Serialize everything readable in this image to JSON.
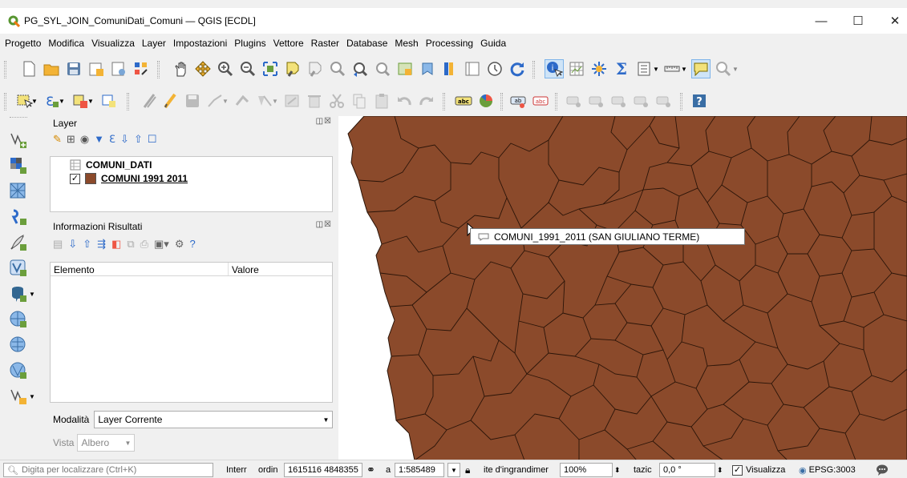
{
  "window": {
    "title": "PG_SYL_JOIN_ComuniDati_Comuni — QGIS [ECDL]",
    "minimize": "—",
    "maximize": "☐",
    "close": "✕"
  },
  "menu": [
    "Progetto",
    "Modifica",
    "Visualizza",
    "Layer",
    "Impostazioni",
    "Plugins",
    "Vettore",
    "Raster",
    "Database",
    "Mesh",
    "Processing",
    "Guida"
  ],
  "layer_panel": {
    "title": "Layer",
    "layers": [
      {
        "name": "COMUNI_DATI",
        "checked": false,
        "type": "table"
      },
      {
        "name": "COMUNI 1991 2011",
        "checked": true,
        "type": "polygon",
        "color": "#8b4a2b"
      }
    ]
  },
  "results_panel": {
    "title": "Informazioni Risultati",
    "col_element": "Elemento",
    "col_value": "Valore",
    "mode_label": "Modalità",
    "mode_value": "Layer Corrente",
    "view_label": "Vista",
    "view_value": "Albero"
  },
  "map": {
    "fill_color": "#8b4a2b",
    "tooltip": "COMUNI_1991_2011 (SAN GIULIANO TERME)"
  },
  "statusbar": {
    "locator_placeholder": "Digita per localizzare (Ctrl+K)",
    "coord_label_a": "Interr",
    "coord_label_b": "ordin",
    "coordinates": "1615116 4848355",
    "scale_label": "a",
    "scale": "1:585489",
    "magnifier_label": "ite d'ingrandimer",
    "magnifier": "100%",
    "rotation_label": "tazic",
    "rotation": "0,0 °",
    "render_label": "Visualizza",
    "crs": "EPSG:3003"
  }
}
